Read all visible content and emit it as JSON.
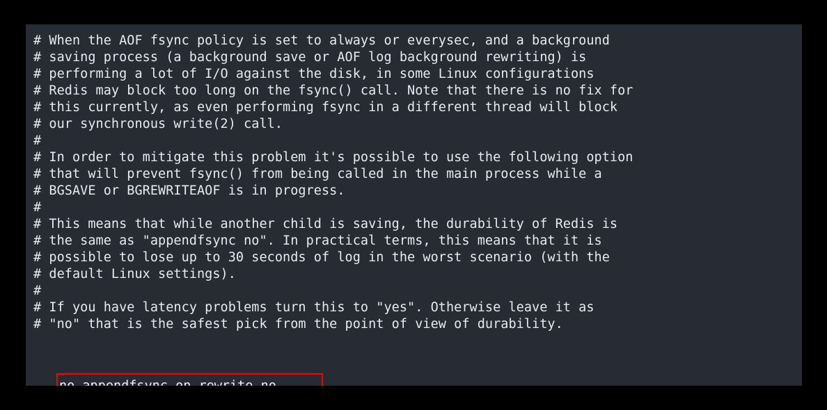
{
  "window": {
    "background_color": "#000000",
    "panel_background_color": "#272b33",
    "text_color": "#e8eaf0"
  },
  "terminal": {
    "comment_lines": [
      "# When the AOF fsync policy is set to always or everysec, and a background",
      "# saving process (a background save or AOF log background rewriting) is",
      "# performing a lot of I/O against the disk, in some Linux configurations",
      "# Redis may block too long on the fsync() call. Note that there is no fix for",
      "# this currently, as even performing fsync in a different thread will block",
      "# our synchronous write(2) call.",
      "#",
      "# In order to mitigate this problem it's possible to use the following option",
      "# that will prevent fsync() from being called in the main process while a",
      "# BGSAVE or BGREWRITEAOF is in progress.",
      "#",
      "# This means that while another child is saving, the durability of Redis is",
      "# the same as \"appendfsync no\". In practical terms, this means that it is",
      "# possible to lose up to 30 seconds of log in the worst scenario (with the",
      "# default Linux settings).",
      "#",
      "# If you have latency problems turn this to \"yes\". Otherwise leave it as",
      "# \"no\" that is the safest pick from the point of view of durability.",
      ""
    ],
    "config_directive": {
      "text": "no-appendfsync-on-rewrite no",
      "key": "no-appendfsync-on-rewrite",
      "value": "no",
      "highlight_color": "#fb0000"
    }
  }
}
